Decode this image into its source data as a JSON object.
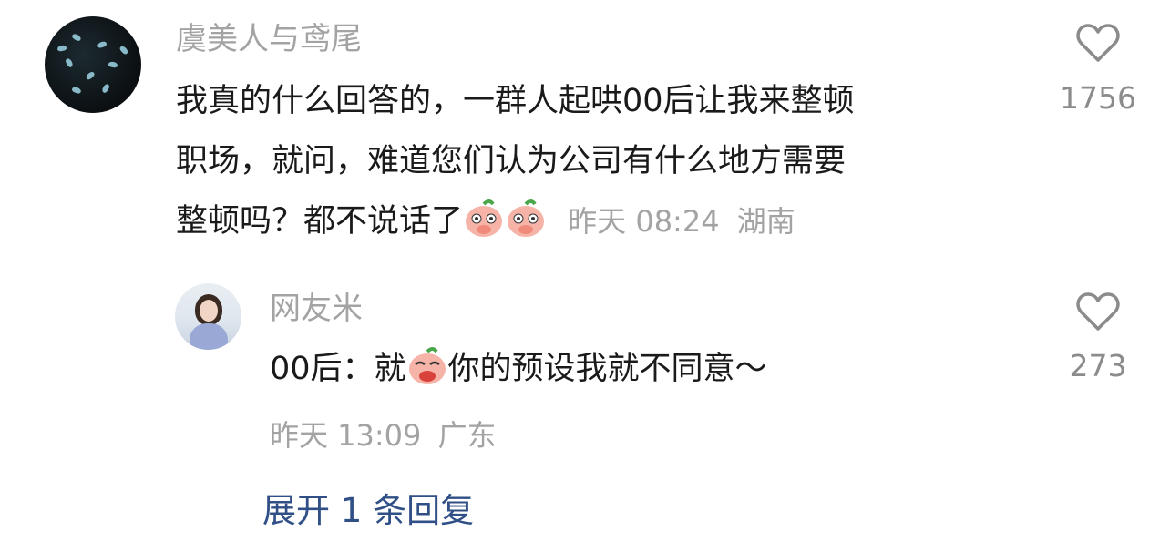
{
  "comment": {
    "username": "虞美人与鸢尾",
    "text_line1": "我真的什么回答的，一群人起哄00后让我来整顿",
    "text_line2": "职场，就问，难道您们认为公司有什么地方需要",
    "text_line3": "整顿吗？都不说话了",
    "time": "昨天 08:24",
    "location": "湖南",
    "like_count": "1756"
  },
  "reply": {
    "username": "网友米",
    "text_prefix": "00后：就",
    "text_suffix": "你的预设我就不同意～",
    "time": "昨天 13:09",
    "location": "广东",
    "like_count": "273"
  },
  "expand_label": "展开 1 条回复",
  "icons": [
    "heart-icon",
    "peach-emoji"
  ],
  "colors": {
    "link": "#2f4f86",
    "meta": "#a3a3a3",
    "text": "#1a1a1a"
  }
}
